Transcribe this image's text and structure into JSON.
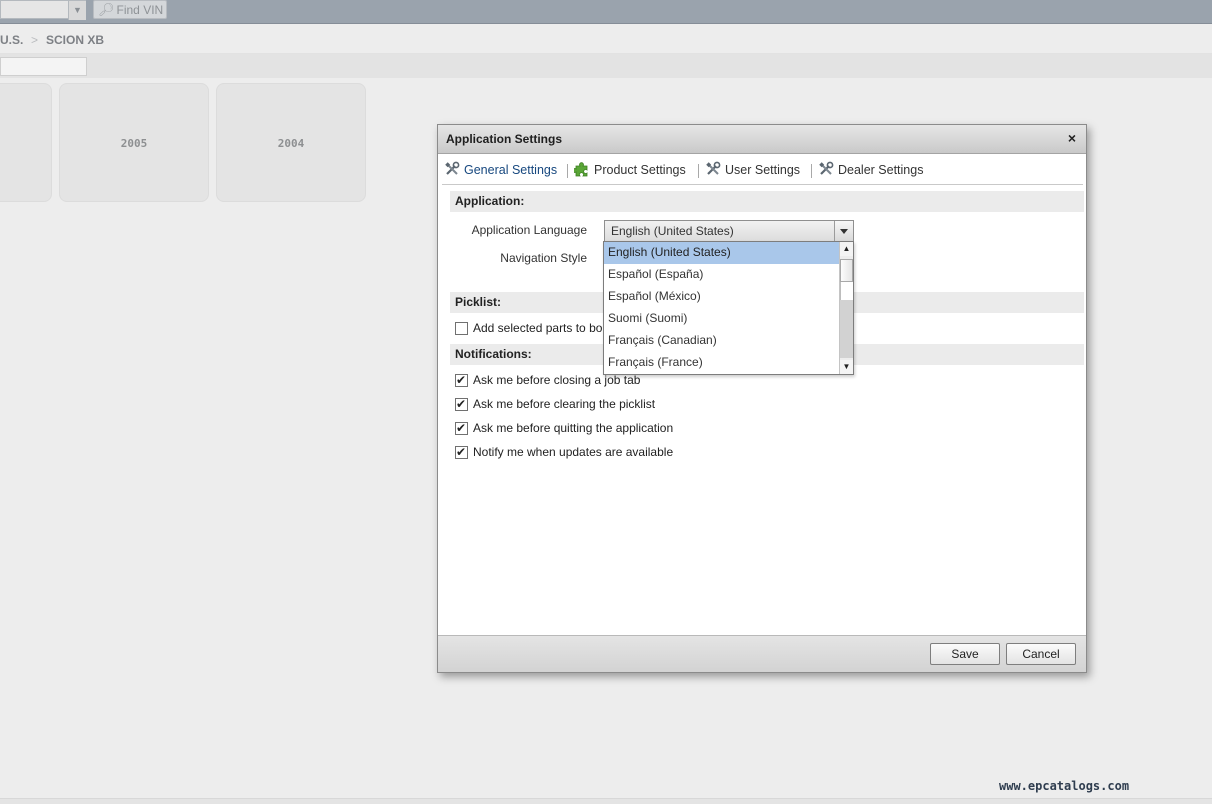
{
  "topbar": {
    "find_vin_label": "Find VIN"
  },
  "breadcrumb": {
    "items": [
      "U.S.",
      "SCION XB"
    ],
    "separator": ">"
  },
  "years": {
    "tiles": [
      "",
      "2005",
      "2004"
    ]
  },
  "dialog": {
    "title": "Application Settings",
    "close_glyph": "×",
    "tabs": [
      {
        "label": "General Settings",
        "icon": "tools-icon",
        "active": true
      },
      {
        "label": "Product Settings",
        "icon": "puzzle-icon",
        "active": false
      },
      {
        "label": "User Settings",
        "icon": "tools-icon",
        "active": false
      },
      {
        "label": "Dealer Settings",
        "icon": "tools-icon",
        "active": false
      }
    ],
    "application": {
      "header": "Application:",
      "language_label": "Application Language",
      "language_value": "English (United States)",
      "navigation_label": "Navigation Style"
    },
    "picklist": {
      "header": "Picklist:",
      "options": [
        {
          "label": "Add selected parts to bo",
          "checked": false
        }
      ]
    },
    "notifications": {
      "header": "Notifications:",
      "options": [
        {
          "label": "Ask me before closing a job tab",
          "checked": true
        },
        {
          "label": "Ask me before clearing the picklist",
          "checked": true
        },
        {
          "label": "Ask me before quitting the application",
          "checked": true
        },
        {
          "label": "Notify me when updates are available",
          "checked": true
        }
      ]
    },
    "footer": {
      "save_label": "Save",
      "cancel_label": "Cancel"
    }
  },
  "language_dropdown": {
    "options": [
      "English (United States)",
      "Español (España)",
      "Español (México)",
      "Suomi (Suomi)",
      "Français (Canadian)",
      "Français (France)"
    ],
    "selected_index": 0,
    "scroll_up_glyph": "▲",
    "scroll_down_glyph": "▼"
  },
  "watermark": "www.epcatalogs.com",
  "colors": {
    "active_tab": "#17487f",
    "selected_option": "#a9c7ea",
    "topbar": "#9aa3ad"
  }
}
